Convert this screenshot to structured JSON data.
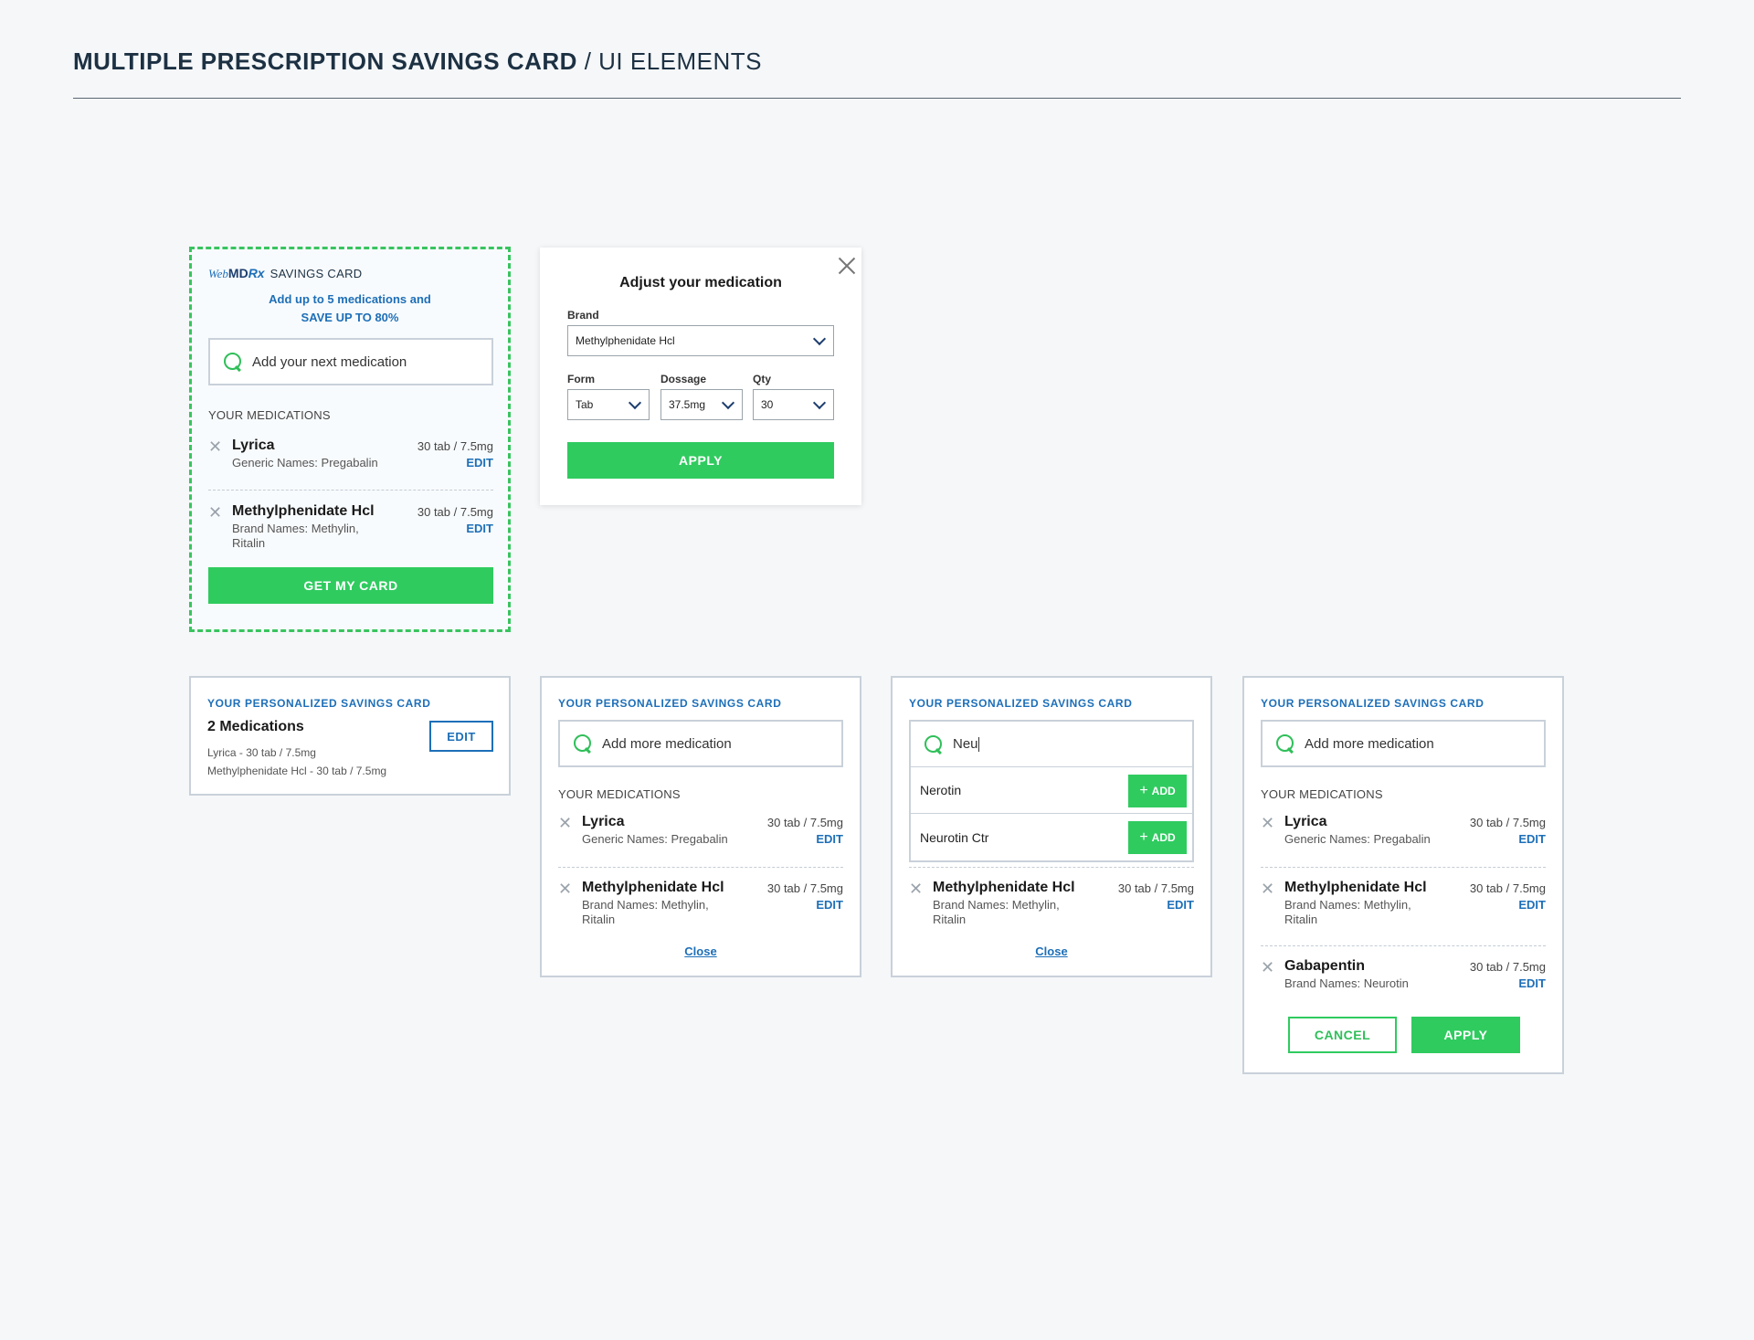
{
  "page": {
    "title_bold": "MULTIPLE PRESCRIPTION SAVINGS CARD",
    "title_thin": " / UI ELEMENTS"
  },
  "colors": {
    "accent_green": "#2fcb5f",
    "accent_blue": "#1d6fb8",
    "header_navy": "#1d3143"
  },
  "widget": {
    "brand_web": "Web",
    "brand_md": "MD",
    "brand_rx": "Rx",
    "brand_label": "SAVINGS CARD",
    "promo_line1": "Add up to 5 medications and",
    "promo_line2": "SAVE UP TO 80%",
    "search_placeholder": "Add your next medication",
    "section_label": "YOUR MEDICATIONS",
    "cta": "GET MY CARD"
  },
  "adjust_modal": {
    "title": "Adjust your medication",
    "brand_label": "Brand",
    "brand_value": "Methylphenidate Hcl",
    "form_label": "Form",
    "form_value": "Tab",
    "dosage_label": "Dossage",
    "dosage_value": "37.5mg",
    "qty_label": "Qty",
    "qty_value": "30",
    "apply": "APPLY"
  },
  "meds": {
    "lyrica": {
      "name": "Lyrica",
      "sub": "Generic Names: Pregabalin",
      "dose": "30 tab / 7.5mg",
      "edit": "EDIT"
    },
    "methyl": {
      "name": "Methylphenidate Hcl",
      "sub1": "Brand Names: Methylin,",
      "sub2": "Ritalin",
      "dose": "30 tab / 7.5mg",
      "edit": "EDIT"
    },
    "gaba": {
      "name": "Gabapentin",
      "sub": "Brand Names: Neurotin",
      "dose": "30 tab / 7.5mg",
      "edit": "EDIT"
    }
  },
  "personalized": {
    "title": "YOUR PERSONALIZED SAVINGS CARD",
    "count": "2 Medications",
    "line1": "Lyrica - 30 tab / 7.5mg",
    "line2": "Methylphenidate Hcl - 30 tab / 7.5mg",
    "edit": "EDIT",
    "add_more_placeholder": "Add more medication",
    "section_label": "YOUR MEDICATIONS",
    "close": "Close",
    "search_query": "Neu",
    "suggestions": [
      "Nerotin",
      "Neurotin Ctr"
    ],
    "add_label": "ADD",
    "cancel": "CANCEL",
    "apply": "APPLY"
  }
}
